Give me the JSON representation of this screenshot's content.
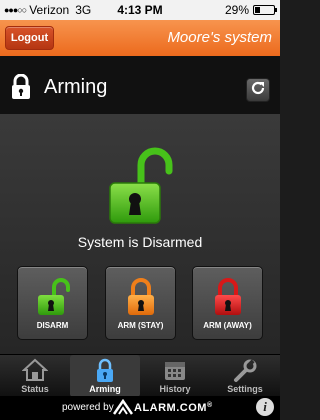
{
  "status_bar": {
    "carrier": "Verizon",
    "network": "3G",
    "time": "4:13 PM",
    "battery_text": "29%",
    "battery_level": 0.29
  },
  "header": {
    "logout_label": "Logout",
    "system_name": "Moore's system",
    "accent_color": "#ec6a1d"
  },
  "page": {
    "title": "Arming",
    "title_icon": "lock-icon",
    "refresh_icon": "refresh-icon"
  },
  "main": {
    "status_text": "System is Disarmed",
    "status_icon": "unlocked-icon",
    "status_color": "#47c21a",
    "buttons": [
      {
        "label": "DISARM",
        "icon": "unlocked-icon",
        "color": "#47c21a"
      },
      {
        "label": "ARM (STAY)",
        "icon": "locked-icon",
        "color": "#f07f1a"
      },
      {
        "label": "ARM (AWAY)",
        "icon": "locked-icon",
        "color": "#d81818"
      }
    ]
  },
  "tabs": [
    {
      "label": "Status",
      "icon": "home-icon",
      "active": false
    },
    {
      "label": "Arming",
      "icon": "lock-icon",
      "active": true
    },
    {
      "label": "History",
      "icon": "calendar-icon",
      "active": false
    },
    {
      "label": "Settings",
      "icon": "wrench-icon",
      "active": false
    }
  ],
  "footer": {
    "powered_by": "powered by",
    "brand": "ALARM.COM",
    "brand_suffix": "®",
    "info_icon": "info-icon"
  }
}
